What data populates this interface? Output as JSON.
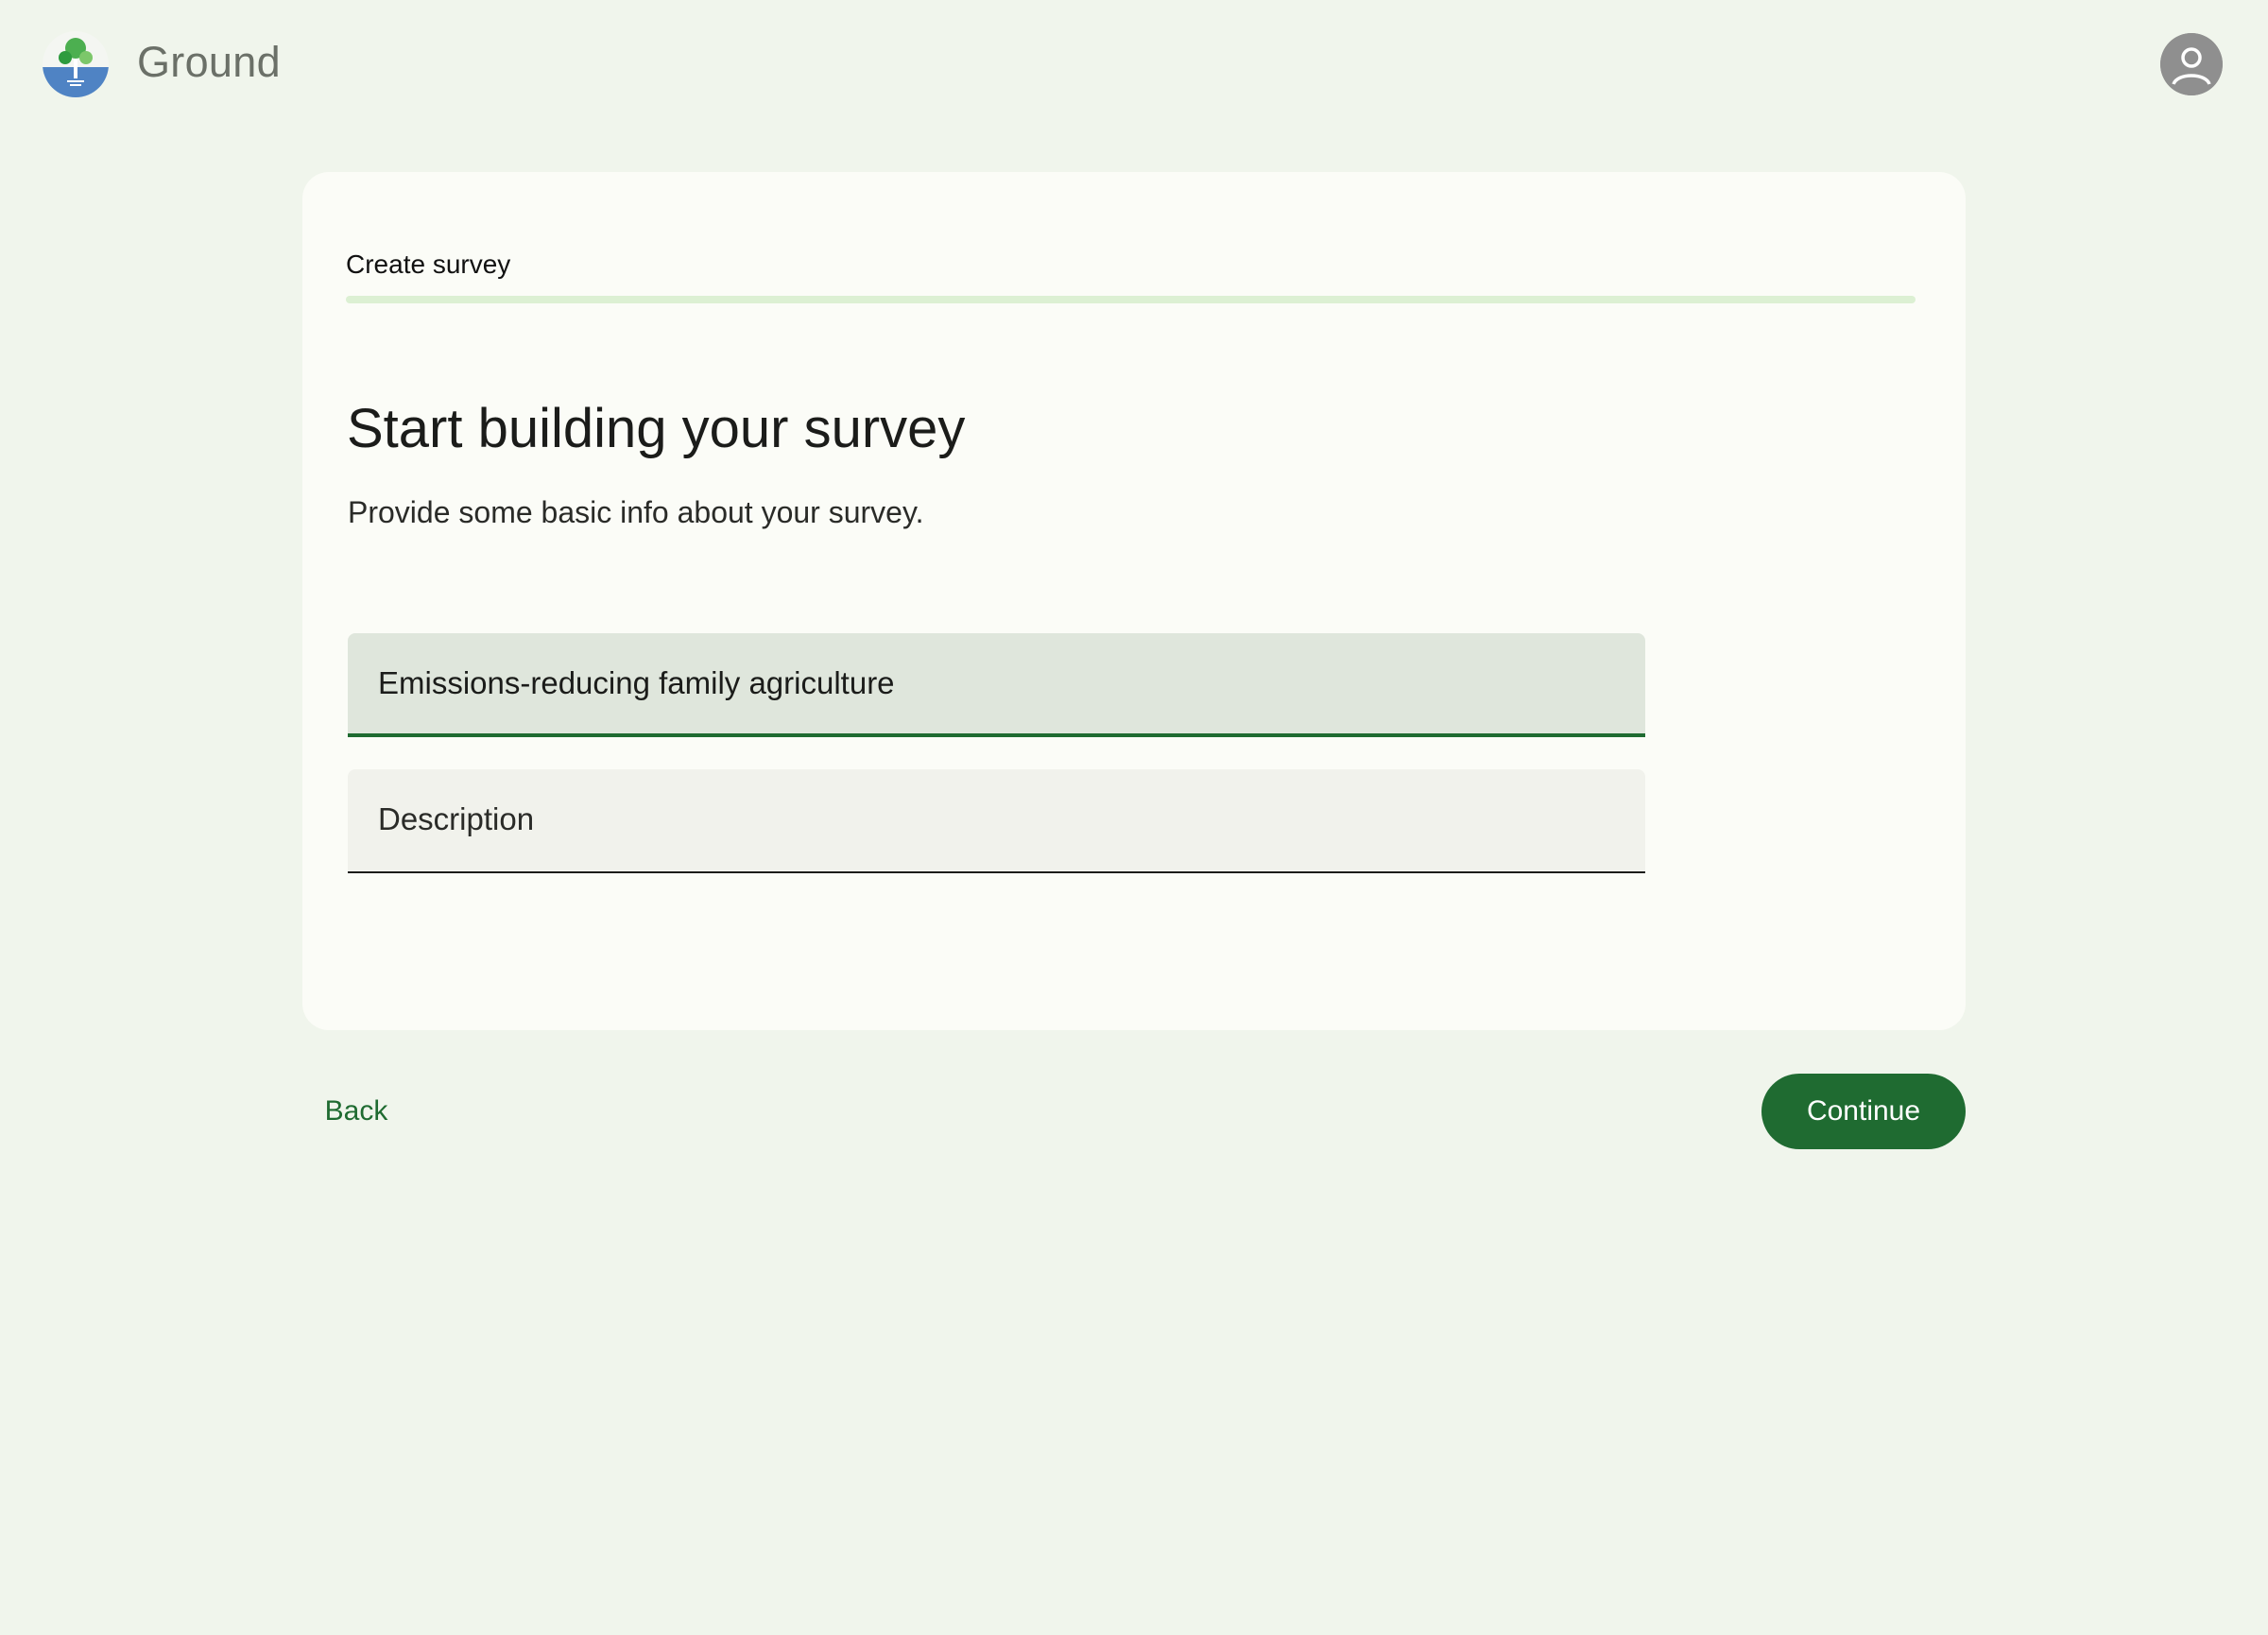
{
  "header": {
    "app_title": "Ground",
    "logo_icon": "ground-tree-logo",
    "account_icon": "account-circle-icon"
  },
  "card": {
    "step_label": "Create survey",
    "progress_fraction": 1,
    "heading": "Start building your survey",
    "subheading": "Provide some basic info about your survey.",
    "title_field": {
      "value": "Emissions-reducing family agriculture",
      "focused": true
    },
    "description_field": {
      "value": "",
      "placeholder": "Description"
    }
  },
  "footer": {
    "back_label": "Back",
    "continue_label": "Continue"
  },
  "colors": {
    "background": "#f0f5ec",
    "card": "#fbfcf7",
    "primary": "#1f6b31",
    "progress_track": "#dcf0d3",
    "field_focused": "#dfe6dc",
    "field": "#f1f2ec"
  }
}
